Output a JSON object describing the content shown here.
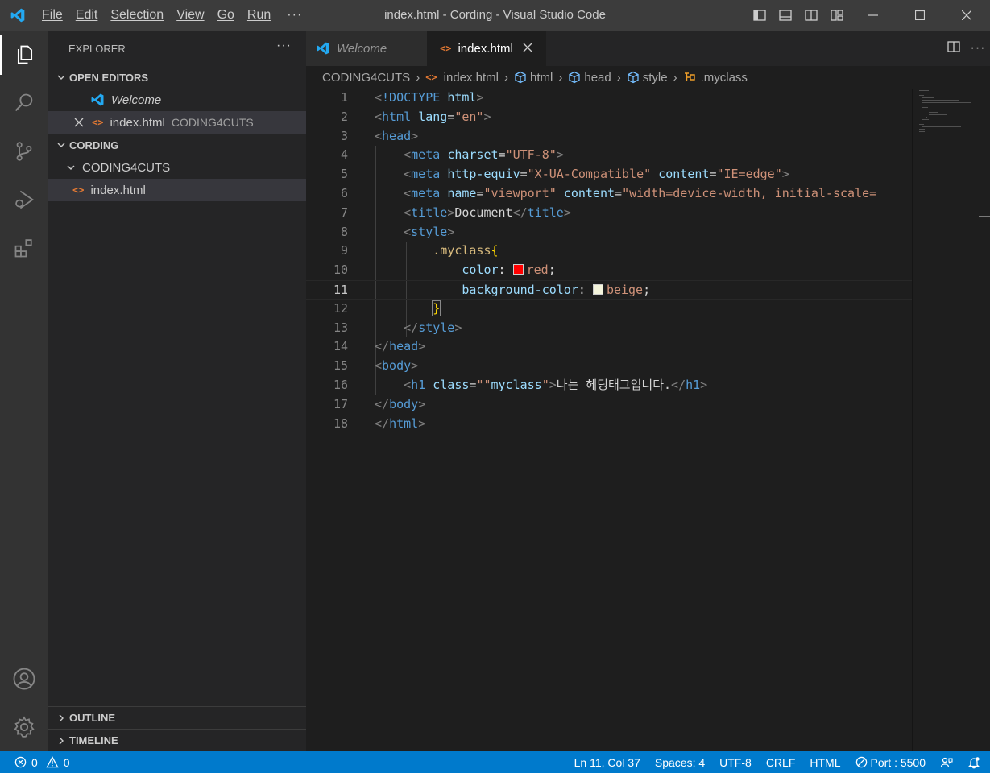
{
  "titlebar": {
    "menu": [
      "File",
      "Edit",
      "Selection",
      "View",
      "Go",
      "Run"
    ],
    "more": "···",
    "title": "index.html - Cording - Visual Studio Code"
  },
  "sidebar": {
    "header": "EXPLORER",
    "more": "···",
    "open_editors": {
      "label": "OPEN EDITORS",
      "items": [
        {
          "name": "Welcome"
        },
        {
          "name": "index.html",
          "desc": "CODING4CUTS"
        }
      ]
    },
    "folder": {
      "label": "CORDING",
      "subfolder": "CODING4CUTS",
      "file": "index.html"
    },
    "outline": "OUTLINE",
    "timeline": "TIMELINE"
  },
  "tabs": [
    {
      "label": "Welcome",
      "active": false
    },
    {
      "label": "index.html",
      "active": true
    }
  ],
  "breadcrumb": [
    "CODING4CUTS",
    "index.html",
    "html",
    "head",
    "style",
    ".myclass"
  ],
  "code": {
    "line_numbers": [
      "1",
      "2",
      "3",
      "4",
      "5",
      "6",
      "7",
      "8",
      "9",
      "10",
      "11",
      "12",
      "13",
      "14",
      "15",
      "16",
      "17",
      "18"
    ],
    "current_line": "11",
    "color_red": "#ff0000",
    "color_beige": "#f5f5dc"
  },
  "statusbar": {
    "errors": "0",
    "warnings": "0",
    "position": "Ln 11, Col 37",
    "spaces": "Spaces: 4",
    "encoding": "UTF-8",
    "eol": "CRLF",
    "language": "HTML",
    "port": "Port : 5500"
  },
  "colors": {
    "accent": "#007acc",
    "activitybar": "#333333",
    "sidebar": "#252526",
    "editor": "#1e1e1e"
  }
}
